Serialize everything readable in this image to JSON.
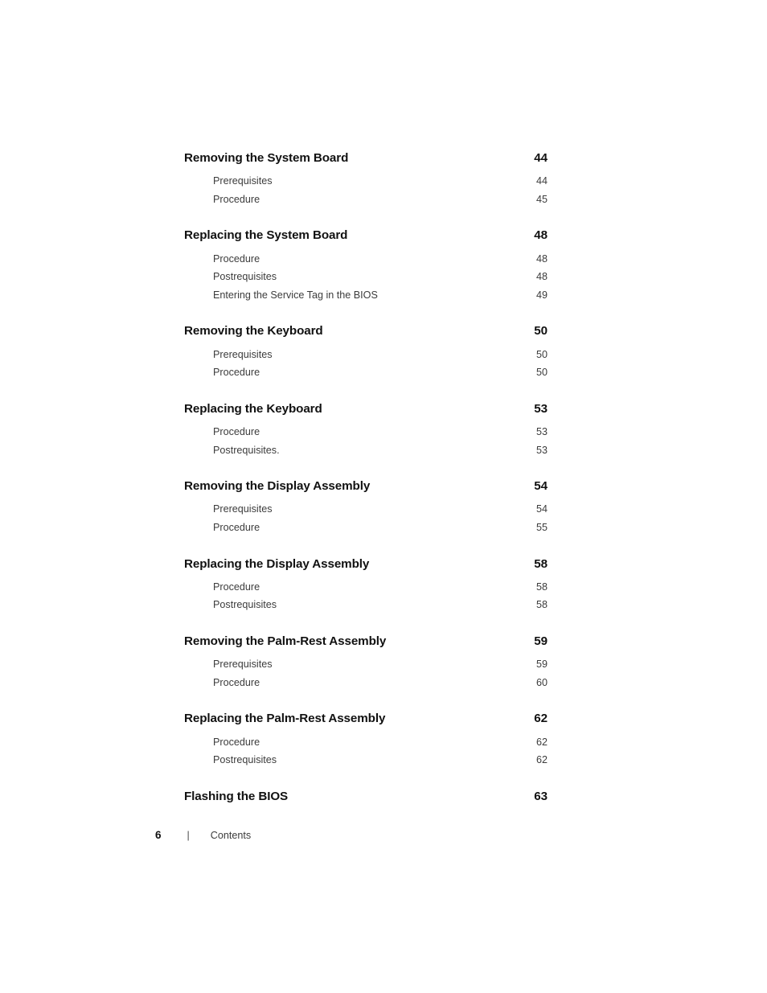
{
  "document": {
    "page_label": "Contents",
    "page_number": "6",
    "separator": "|"
  },
  "toc": {
    "groups": [
      {
        "title": "Removing the System Board",
        "page": "44",
        "subs": [
          {
            "title": "Prerequisites",
            "page": "44"
          },
          {
            "title": "Procedure",
            "page": "45"
          }
        ]
      },
      {
        "title": "Replacing the System Board",
        "page": "48",
        "subs": [
          {
            "title": "Procedure",
            "page": "48"
          },
          {
            "title": "Postrequisites",
            "page": "48"
          },
          {
            "title": "Entering the Service Tag in the BIOS",
            "page": "49"
          }
        ]
      },
      {
        "title": "Removing the Keyboard",
        "page": "50",
        "subs": [
          {
            "title": "Prerequisites",
            "page": "50"
          },
          {
            "title": "Procedure",
            "page": "50"
          }
        ]
      },
      {
        "title": "Replacing the Keyboard",
        "page": "53",
        "subs": [
          {
            "title": "Procedure",
            "page": "53"
          },
          {
            "title": "Postrequisites.",
            "page": "53"
          }
        ]
      },
      {
        "title": "Removing the Display Assembly",
        "page": "54",
        "subs": [
          {
            "title": "Prerequisites",
            "page": "54"
          },
          {
            "title": "Procedure",
            "page": "55"
          }
        ]
      },
      {
        "title": "Replacing the Display Assembly",
        "page": "58",
        "subs": [
          {
            "title": "Procedure",
            "page": "58"
          },
          {
            "title": "Postrequisites",
            "page": "58"
          }
        ]
      },
      {
        "title": "Removing the Palm-Rest Assembly",
        "page": "59",
        "subs": [
          {
            "title": "Prerequisites",
            "page": "59"
          },
          {
            "title": "Procedure",
            "page": "60"
          }
        ]
      },
      {
        "title": "Replacing the Palm-Rest Assembly",
        "page": "62",
        "subs": [
          {
            "title": "Procedure",
            "page": "62"
          },
          {
            "title": "Postrequisites",
            "page": "62"
          }
        ]
      },
      {
        "title": "Flashing the BIOS",
        "page": "63",
        "subs": []
      }
    ]
  },
  "colors": {
    "background": "#ffffff",
    "heading_text": "#111111",
    "sub_text": "#3c3c3c"
  }
}
